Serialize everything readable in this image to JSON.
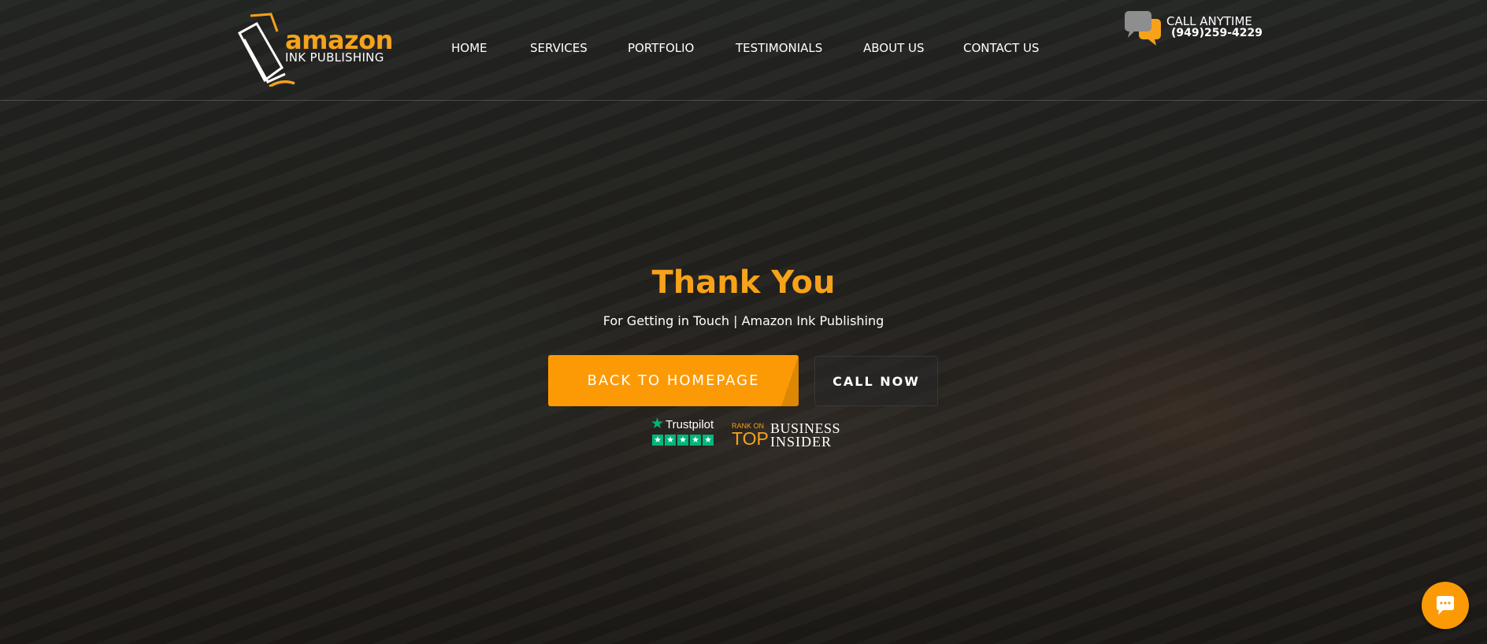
{
  "brand": {
    "logo_word": "amazon",
    "logo_sub": "INK PUBLISHING",
    "accent_color": "#fc9a05",
    "title_color": "#f7a21b"
  },
  "nav": {
    "items": [
      {
        "label": "HOME"
      },
      {
        "label": "SERVICES"
      },
      {
        "label": "PORTFOLIO"
      },
      {
        "label": "TESTIMONIALS"
      },
      {
        "label": "ABOUT US"
      },
      {
        "label": "CONTACT US"
      }
    ]
  },
  "call": {
    "label": "CALL ANYTIME",
    "number": "(949)259-4229",
    "icon": "chat-bubbles-icon"
  },
  "hero": {
    "title": "Thank You",
    "subtitle": "For Getting in Touch | Amazon Ink Publishing",
    "primary_button": "BACK TO HOMEPAGE",
    "secondary_button": "CALL NOW"
  },
  "badges": {
    "trustpilot": {
      "name": "Trustpilot",
      "stars": 5,
      "color": "#00b67a"
    },
    "business_insider": {
      "rank_on": "RANK ON",
      "top": "TOP",
      "line1": "BUSINESS",
      "line2": "INSIDER"
    }
  },
  "chat_widget": {
    "icon": "chat-icon"
  }
}
